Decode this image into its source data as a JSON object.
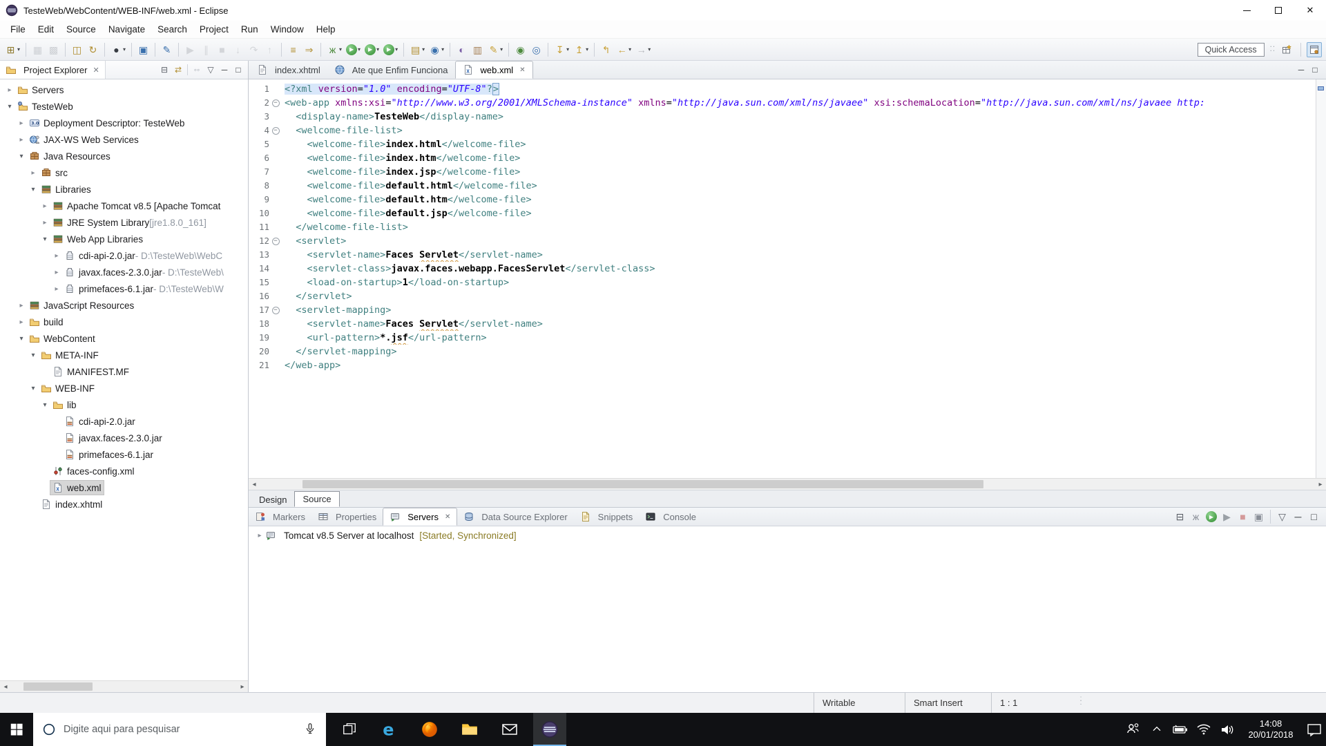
{
  "window": {
    "title": "TesteWeb/WebContent/WEB-INF/web.xml - Eclipse"
  },
  "menu": {
    "items": [
      "File",
      "Edit",
      "Source",
      "Navigate",
      "Search",
      "Project",
      "Run",
      "Window",
      "Help"
    ]
  },
  "toolbar": {
    "quick_access": "Quick Access",
    "items": [
      {
        "n": "new",
        "g": "⊞",
        "c": "#8f7a2e",
        "dd": 1
      },
      {
        "sep": 1
      },
      {
        "n": "save",
        "g": "▦",
        "c": "#a9adb3",
        "dim": 1
      },
      {
        "n": "save-all",
        "g": "▩",
        "c": "#a9adb3",
        "dim": 1
      },
      {
        "sep": 1
      },
      {
        "n": "export-jar",
        "g": "◫",
        "c": "#b08d2f"
      },
      {
        "n": "refresh",
        "g": "↻",
        "c": "#b08d2f"
      },
      {
        "sep": 1
      },
      {
        "n": "user",
        "g": "●",
        "c": "#383c43",
        "dd": 1
      },
      {
        "sep": 1
      },
      {
        "n": "open-element",
        "g": "▣",
        "c": "#3a70ad"
      },
      {
        "sep": 1
      },
      {
        "n": "annotate",
        "g": "✎",
        "c": "#3a70ad"
      },
      {
        "sep": 1
      },
      {
        "n": "resume",
        "g": "▶",
        "c": "#b6b9be",
        "dim": 1
      },
      {
        "n": "suspend",
        "g": "∥",
        "c": "#b6b9be",
        "dim": 1
      },
      {
        "n": "terminate",
        "g": "■",
        "c": "#b6b9be",
        "dim": 1
      },
      {
        "n": "step-into",
        "g": "↓",
        "c": "#b6b9be",
        "dim": 1
      },
      {
        "n": "step-over",
        "g": "↷",
        "c": "#b6b9be",
        "dim": 1
      },
      {
        "n": "step-return",
        "g": "↑",
        "c": "#b6b9be",
        "dim": 1
      },
      {
        "sep": 1
      },
      {
        "n": "run-last",
        "g": "≡",
        "c": "#b08d2f"
      },
      {
        "n": "run-config",
        "g": "⇒",
        "c": "#b08d2f"
      },
      {
        "sep": 1
      },
      {
        "n": "debug",
        "g": "ж",
        "c": "#4c8a3d",
        "dd": 1
      },
      {
        "n": "run",
        "gp": 1,
        "dd": 1
      },
      {
        "n": "run-on-server",
        "gp": 1,
        "dd": 1
      },
      {
        "n": "profile",
        "gp": 1,
        "dd": 1
      },
      {
        "sep": 1
      },
      {
        "n": "new-server",
        "g": "▤",
        "c": "#b08d2f",
        "dd": 1
      },
      {
        "n": "web-service",
        "g": "◉",
        "c": "#3a70ad",
        "dd": 1
      },
      {
        "sep": 1
      },
      {
        "n": "xml-catalog",
        "g": "◐",
        "c": "#7a5ea6"
      },
      {
        "n": "clipboard",
        "g": "▥",
        "c": "#a8835a"
      },
      {
        "n": "highlight",
        "g": "✎",
        "c": "#c9a23a",
        "dd": 1
      },
      {
        "sep": 1
      },
      {
        "n": "browser",
        "g": "◉",
        "c": "#4c8a3d"
      },
      {
        "n": "external-browser",
        "g": "◎",
        "c": "#3a70ad"
      },
      {
        "sep": 1
      },
      {
        "n": "import",
        "g": "↧",
        "c": "#c9a23a",
        "dd": 1
      },
      {
        "n": "export",
        "g": "↥",
        "c": "#c9a23a",
        "dd": 1
      },
      {
        "sep": 1
      },
      {
        "n": "last-edit",
        "g": "↰",
        "c": "#c9a23a"
      },
      {
        "n": "back",
        "g": "←",
        "c": "#c9a23a",
        "dd": 1
      },
      {
        "n": "forward",
        "g": "→",
        "c": "#b6b9be",
        "dd": 1
      }
    ]
  },
  "explorer": {
    "title": "Project Explorer",
    "tools": [
      {
        "n": "collapse-all",
        "g": "⊟",
        "c": "#5a5f66"
      },
      {
        "n": "link-with-editor",
        "g": "⇄",
        "c": "#b08d2f"
      },
      {
        "sep": 1
      },
      {
        "n": "focus-task",
        "g": "◦◦",
        "c": "#9aa0a8"
      },
      {
        "n": "view-menu",
        "g": "▽",
        "c": "#5a5f66"
      },
      {
        "n": "minimize",
        "g": "─",
        "c": "#3c4043"
      },
      {
        "n": "maximize",
        "g": "□",
        "c": "#3c4043"
      }
    ],
    "tree": [
      {
        "ind": 0,
        "ar": 1,
        "ic": "folder",
        "label": "Servers"
      },
      {
        "ind": 0,
        "ar": 2,
        "ic": "project",
        "label": "TesteWeb"
      },
      {
        "ind": 1,
        "ar": 1,
        "ic": "dd",
        "label": "Deployment Descriptor: TesteWeb"
      },
      {
        "ind": 1,
        "ar": 1,
        "ic": "jaxws",
        "label": "JAX-WS Web Services"
      },
      {
        "ind": 1,
        "ar": 2,
        "ic": "pkg",
        "label": "Java Resources"
      },
      {
        "ind": 2,
        "ar": 1,
        "ic": "pkg",
        "label": "src"
      },
      {
        "ind": 2,
        "ar": 2,
        "ic": "lib",
        "label": "Libraries"
      },
      {
        "ind": 3,
        "ar": 1,
        "ic": "lib",
        "label": "Apache Tomcat v8.5 [Apache Tomcat"
      },
      {
        "ind": 3,
        "ar": 1,
        "ic": "lib",
        "label": "JRE System Library",
        "dim": " [jre1.8.0_161]"
      },
      {
        "ind": 3,
        "ar": 2,
        "ic": "lib",
        "label": "Web App Libraries"
      },
      {
        "ind": 4,
        "ar": 1,
        "ic": "jar",
        "label": "cdi-api-2.0.jar",
        "dim": " - D:\\TesteWeb\\WebC"
      },
      {
        "ind": 4,
        "ar": 1,
        "ic": "jar",
        "label": "javax.faces-2.3.0.jar",
        "dim": " - D:\\TesteWeb\\"
      },
      {
        "ind": 4,
        "ar": 1,
        "ic": "jar",
        "label": "primefaces-6.1.jar",
        "dim": " - D:\\TesteWeb\\W"
      },
      {
        "ind": 1,
        "ar": 1,
        "ic": "lib",
        "label": "JavaScript Resources"
      },
      {
        "ind": 1,
        "ar": 1,
        "ic": "folder",
        "label": "build"
      },
      {
        "ind": 1,
        "ar": 2,
        "ic": "folder",
        "label": "WebContent"
      },
      {
        "ind": 2,
        "ar": 2,
        "ic": "folder",
        "label": "META-INF"
      },
      {
        "ind": 3,
        "ar": 0,
        "ic": "page",
        "label": "MANIFEST.MF"
      },
      {
        "ind": 2,
        "ar": 2,
        "ic": "folder",
        "label": "WEB-INF"
      },
      {
        "ind": 3,
        "ar": 2,
        "ic": "folder",
        "label": "lib"
      },
      {
        "ind": 4,
        "ar": 0,
        "ic": "jar2",
        "label": "cdi-api-2.0.jar"
      },
      {
        "ind": 4,
        "ar": 0,
        "ic": "jar2",
        "label": "javax.faces-2.3.0.jar"
      },
      {
        "ind": 4,
        "ar": 0,
        "ic": "jar2",
        "label": "primefaces-6.1.jar"
      },
      {
        "ind": 3,
        "ar": 0,
        "ic": "cfg",
        "label": "faces-config.xml"
      },
      {
        "ind": 3,
        "ar": 0,
        "ic": "xml",
        "label": "web.xml",
        "selected": true
      },
      {
        "ind": 2,
        "ar": 0,
        "ic": "page",
        "label": "index.xhtml"
      }
    ]
  },
  "editor": {
    "tabs": [
      {
        "ic": "page",
        "label": "index.xhtml"
      },
      {
        "ic": "globe",
        "label": "Ate que Enfim Funciona"
      },
      {
        "ic": "xml",
        "label": "web.xml",
        "active": true
      }
    ],
    "views": {
      "design": "Design",
      "source": "Source",
      "active": "Source"
    },
    "colors": {
      "tag": "#3f7f7f",
      "attribute": "#7f007f",
      "value": "#2a00ff",
      "selection": "#d8e7fa"
    },
    "code": {
      "lines": [
        {
          "n": 1,
          "sel": true,
          "segs": [
            [
              "t",
              "<?xml "
            ],
            [
              "a",
              "version"
            ],
            [
              "e",
              "="
            ],
            [
              "v",
              "\"1.0\""
            ],
            [
              "e",
              " "
            ],
            [
              "a",
              "encoding"
            ],
            [
              "e",
              "="
            ],
            [
              "v",
              "\"UTF-8\""
            ],
            [
              "t",
              "?"
            ],
            [
              "x",
              ">"
            ]
          ]
        },
        {
          "n": 2,
          "fold": 1,
          "segs": [
            [
              "t",
              "<web-app "
            ],
            [
              "a",
              "xmlns:xsi"
            ],
            [
              "e",
              "="
            ],
            [
              "v",
              "\"http://www.w3.org/2001/XMLSchema-instance\""
            ],
            [
              "e",
              " "
            ],
            [
              "a",
              "xmlns"
            ],
            [
              "e",
              "="
            ],
            [
              "v",
              "\"http://java.sun.com/xml/ns/javaee\""
            ],
            [
              "e",
              " "
            ],
            [
              "a",
              "xsi:schemaLocation"
            ],
            [
              "e",
              "="
            ],
            [
              "v",
              "\"http://java.sun.com/xml/ns/javaee http:"
            ]
          ]
        },
        {
          "n": 3,
          "segs": [
            [
              "e",
              "  "
            ],
            [
              "t",
              "<display-name>"
            ],
            [
              "c",
              "TesteWeb"
            ],
            [
              "t",
              "</display-name>"
            ]
          ]
        },
        {
          "n": 4,
          "fold": 1,
          "segs": [
            [
              "e",
              "  "
            ],
            [
              "t",
              "<welcome-file-list>"
            ]
          ]
        },
        {
          "n": 5,
          "segs": [
            [
              "e",
              "    "
            ],
            [
              "t",
              "<welcome-file>"
            ],
            [
              "c",
              "index.html"
            ],
            [
              "t",
              "</welcome-file>"
            ]
          ]
        },
        {
          "n": 6,
          "segs": [
            [
              "e",
              "    "
            ],
            [
              "t",
              "<welcome-file>"
            ],
            [
              "c",
              "index.htm"
            ],
            [
              "t",
              "</welcome-file>"
            ]
          ]
        },
        {
          "n": 7,
          "segs": [
            [
              "e",
              "    "
            ],
            [
              "t",
              "<welcome-file>"
            ],
            [
              "c",
              "index.jsp"
            ],
            [
              "t",
              "</welcome-file>"
            ]
          ]
        },
        {
          "n": 8,
          "segs": [
            [
              "e",
              "    "
            ],
            [
              "t",
              "<welcome-file>"
            ],
            [
              "c",
              "default.html"
            ],
            [
              "t",
              "</welcome-file>"
            ]
          ]
        },
        {
          "n": 9,
          "segs": [
            [
              "e",
              "    "
            ],
            [
              "t",
              "<welcome-file>"
            ],
            [
              "c",
              "default.htm"
            ],
            [
              "t",
              "</welcome-file>"
            ]
          ]
        },
        {
          "n": 10,
          "segs": [
            [
              "e",
              "    "
            ],
            [
              "t",
              "<welcome-file>"
            ],
            [
              "c",
              "default.jsp"
            ],
            [
              "t",
              "</welcome-file>"
            ]
          ]
        },
        {
          "n": 11,
          "segs": [
            [
              "e",
              "  "
            ],
            [
              "t",
              "</welcome-file-list>"
            ]
          ]
        },
        {
          "n": 12,
          "fold": 1,
          "segs": [
            [
              "e",
              "  "
            ],
            [
              "t",
              "<servlet>"
            ]
          ]
        },
        {
          "n": 13,
          "segs": [
            [
              "e",
              "    "
            ],
            [
              "t",
              "<servlet-name>"
            ],
            [
              "c",
              "Faces "
            ],
            [
              "m",
              "Servlet"
            ],
            [
              "t",
              "</servlet-name>"
            ]
          ]
        },
        {
          "n": 14,
          "segs": [
            [
              "e",
              "    "
            ],
            [
              "t",
              "<servlet-class>"
            ],
            [
              "c",
              "javax.faces.webapp.FacesServlet"
            ],
            [
              "t",
              "</servlet-class>"
            ]
          ]
        },
        {
          "n": 15,
          "segs": [
            [
              "e",
              "    "
            ],
            [
              "t",
              "<load-on-startup>"
            ],
            [
              "c",
              "1"
            ],
            [
              "t",
              "</load-on-startup>"
            ]
          ]
        },
        {
          "n": 16,
          "segs": [
            [
              "e",
              "  "
            ],
            [
              "t",
              "</servlet>"
            ]
          ]
        },
        {
          "n": 17,
          "fold": 1,
          "segs": [
            [
              "e",
              "  "
            ],
            [
              "t",
              "<servlet-mapping>"
            ]
          ]
        },
        {
          "n": 18,
          "segs": [
            [
              "e",
              "    "
            ],
            [
              "t",
              "<servlet-name>"
            ],
            [
              "c",
              "Faces "
            ],
            [
              "m",
              "Servlet"
            ],
            [
              "t",
              "</servlet-name>"
            ]
          ]
        },
        {
          "n": 19,
          "segs": [
            [
              "e",
              "    "
            ],
            [
              "t",
              "<url-pattern>"
            ],
            [
              "c",
              "*."
            ],
            [
              "m",
              "jsf"
            ],
            [
              "t",
              "</url-pattern>"
            ]
          ]
        },
        {
          "n": 20,
          "segs": [
            [
              "e",
              "  "
            ],
            [
              "t",
              "</servlet-mapping>"
            ]
          ]
        },
        {
          "n": 21,
          "segs": [
            [
              "t",
              "</web-app>"
            ]
          ]
        }
      ]
    }
  },
  "panel": {
    "tabs": [
      {
        "ic": "markers",
        "label": "Markers"
      },
      {
        "ic": "properties",
        "label": "Properties"
      },
      {
        "ic": "servers",
        "label": "Servers",
        "active": true
      },
      {
        "ic": "datasource",
        "label": "Data Source Explorer"
      },
      {
        "ic": "snippets",
        "label": "Snippets"
      },
      {
        "ic": "console",
        "label": "Console"
      }
    ],
    "tools": [
      {
        "n": "collapse-all",
        "g": "⊟",
        "c": "#5a5f66"
      },
      {
        "n": "debug-server",
        "g": "ж",
        "c": "#8a8f98"
      },
      {
        "n": "start-server",
        "gp": 1
      },
      {
        "n": "profile-server",
        "g": "▶",
        "c": "#9aa0a6"
      },
      {
        "n": "stop-server",
        "g": "■",
        "c": "#d49a9a"
      },
      {
        "n": "publish",
        "g": "▣",
        "c": "#8a8f98"
      },
      {
        "sep": 1
      },
      {
        "n": "view-menu",
        "g": "▽",
        "c": "#5a5f66"
      },
      {
        "n": "minimize",
        "g": "─",
        "c": "#3c4043"
      },
      {
        "n": "maximize",
        "g": "□",
        "c": "#3c4043"
      }
    ],
    "server": {
      "label": "Tomcat v8.5 Server at localhost",
      "state": "[Started, Synchronized]",
      "state_color": "#8a7b25"
    }
  },
  "status": {
    "writable": "Writable",
    "insert_mode": "Smart Insert",
    "caret": "1 : 1"
  },
  "taskbar": {
    "search_placeholder": "Digite aqui para pesquisar",
    "time": "14:08",
    "date": "20/01/2018"
  }
}
